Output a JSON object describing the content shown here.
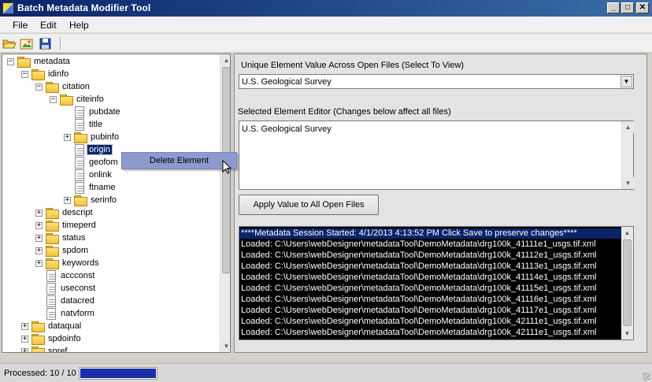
{
  "window": {
    "title": "Batch Metadata Modifier Tool"
  },
  "title_buttons": [
    "_",
    "□",
    "✕"
  ],
  "menu": [
    "File",
    "Edit",
    "Help"
  ],
  "toolbar": {
    "icons": [
      "open-folder-icon",
      "open-image-icon",
      "save-icon"
    ]
  },
  "tree": {
    "nodes": [
      {
        "label": "metadata",
        "depth": 0,
        "type": "folder",
        "expander": "−"
      },
      {
        "label": "idinfo",
        "depth": 1,
        "type": "folder",
        "expander": "−"
      },
      {
        "label": "citation",
        "depth": 2,
        "type": "folder",
        "expander": "−"
      },
      {
        "label": "citeinfo",
        "depth": 3,
        "type": "folder",
        "expander": "−"
      },
      {
        "label": "pubdate",
        "depth": 4,
        "type": "doc",
        "expander": ""
      },
      {
        "label": "title",
        "depth": 4,
        "type": "doc",
        "expander": ""
      },
      {
        "label": "pubinfo",
        "depth": 4,
        "type": "folder",
        "expander": "+"
      },
      {
        "label": "origin",
        "depth": 4,
        "type": "doc",
        "expander": "",
        "selected": true
      },
      {
        "label": "geofom",
        "depth": 4,
        "type": "doc",
        "expander": ""
      },
      {
        "label": "onlink",
        "depth": 4,
        "type": "doc",
        "expander": ""
      },
      {
        "label": "ftname",
        "depth": 4,
        "type": "doc",
        "expander": ""
      },
      {
        "label": "serinfo",
        "depth": 4,
        "type": "folder",
        "expander": "+"
      },
      {
        "label": "descript",
        "depth": 2,
        "type": "folder",
        "expander": "+"
      },
      {
        "label": "timeperd",
        "depth": 2,
        "type": "folder",
        "expander": "+"
      },
      {
        "label": "status",
        "depth": 2,
        "type": "folder",
        "expander": "+"
      },
      {
        "label": "spdom",
        "depth": 2,
        "type": "folder",
        "expander": "+"
      },
      {
        "label": "keywords",
        "depth": 2,
        "type": "folder",
        "expander": "+"
      },
      {
        "label": "accconst",
        "depth": 2,
        "type": "doc",
        "expander": ""
      },
      {
        "label": "useconst",
        "depth": 2,
        "type": "doc",
        "expander": ""
      },
      {
        "label": "datacred",
        "depth": 2,
        "type": "doc",
        "expander": ""
      },
      {
        "label": "natvform",
        "depth": 2,
        "type": "doc",
        "expander": ""
      },
      {
        "label": "dataqual",
        "depth": 1,
        "type": "folder",
        "expander": "+"
      },
      {
        "label": "spdoinfo",
        "depth": 1,
        "type": "folder",
        "expander": "+"
      },
      {
        "label": "spref",
        "depth": 1,
        "type": "folder",
        "expander": "+"
      }
    ]
  },
  "context_menu": {
    "item": "Delete Element"
  },
  "right": {
    "unique_label": "Unique Element Value Across Open Files (Select To View)",
    "unique_value": "U.S. Geological Survey",
    "editor_label": "Selected Element Editor (Changes below affect all files)",
    "editor_value": "U.S. Geological Survey",
    "apply_button": "Apply Value to All Open Files"
  },
  "log": {
    "header": "****Metadata Session Started: 4/1/2013 4:13:52 PM Click Save to preserve changes****",
    "lines": [
      "Loaded: C:\\Users\\webDesigner\\metadataTool\\DemoMetadata\\drg100k_41111e1_usgs.tif.xml",
      "Loaded: C:\\Users\\webDesigner\\metadataTool\\DemoMetadata\\drg100k_41112e1_usgs.tif.xml",
      "Loaded: C:\\Users\\webDesigner\\metadataTool\\DemoMetadata\\drg100k_41113e1_usgs.tif.xml",
      "Loaded: C:\\Users\\webDesigner\\metadataTool\\DemoMetadata\\drg100k_41114e1_usgs.tif.xml",
      "Loaded: C:\\Users\\webDesigner\\metadataTool\\DemoMetadata\\drg100k_41115e1_usgs.tif.xml",
      "Loaded: C:\\Users\\webDesigner\\metadataTool\\DemoMetadata\\drg100k_41116e1_usgs.tif.xml",
      "Loaded: C:\\Users\\webDesigner\\metadataTool\\DemoMetadata\\drg100k_41117e1_usgs.tif.xml",
      "Loaded: C:\\Users\\webDesigner\\metadataTool\\DemoMetadata\\drg100k_42111e1_usgs.tif.xml",
      "Loaded: C:\\Users\\webDesigner\\metadataTool\\DemoMetadata\\drg100k_42111e1_usgs.tif.xml",
      "Loaded: C:\\Users\\webDesigner\\metadataTool\\DemoMetadata\\drg100k_42112a1_usgs.tif.xml"
    ]
  },
  "status": {
    "processed_label": "Processed: 10 / 10",
    "progress_fraction": 1.0
  },
  "colors": {
    "selection": "#0a246a",
    "progress": "#1a2fa8",
    "context_menu": "#8e9acd"
  }
}
